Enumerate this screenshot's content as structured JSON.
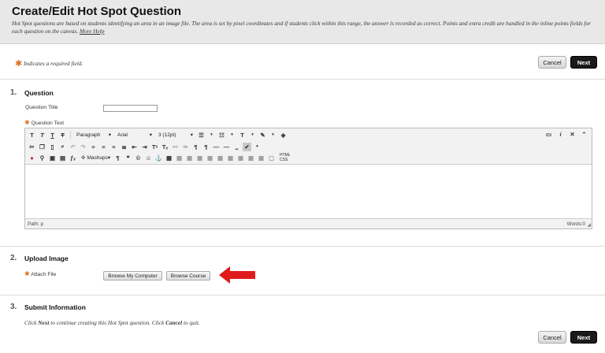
{
  "header": {
    "title": "Create/Edit Hot Spot Question",
    "description": "Hot Spot questions are based on students identifying an area in an image file. The area is set by pixel coordinates and if students click within this range, the answer is recorded as correct. Points and extra credit are handled in the inline points fields for each question on the canvas.",
    "more_help": "More Help"
  },
  "required_note": "Indicates a required field.",
  "buttons": {
    "cancel": "Cancel",
    "next": "Next"
  },
  "sections": {
    "question": {
      "number": "1.",
      "title": "Question",
      "title_label": "Question Title",
      "text_label": "Question Text"
    },
    "upload": {
      "number": "2.",
      "title": "Upload Image",
      "attach_label": "Attach File",
      "browse_computer": "Browse My Computer",
      "browse_course": "Browse Course"
    },
    "submit": {
      "number": "3.",
      "title": "Submit Information",
      "instruction_pre": "Click ",
      "instruction_next": "Next",
      "instruction_mid": " to continue creating this Hot Spot question. Click ",
      "instruction_cancel": "Cancel",
      "instruction_post": " to quit."
    }
  },
  "editor": {
    "format_select": "Paragraph",
    "font_select": "Arial",
    "size_select": "3 (12pt)",
    "mashups": "Mashups",
    "html_css": "HTML CSS",
    "path": "Path: p",
    "words": "Words:0"
  },
  "colors": {
    "arrow": "#e01b1b",
    "required_star": "#e07020"
  }
}
